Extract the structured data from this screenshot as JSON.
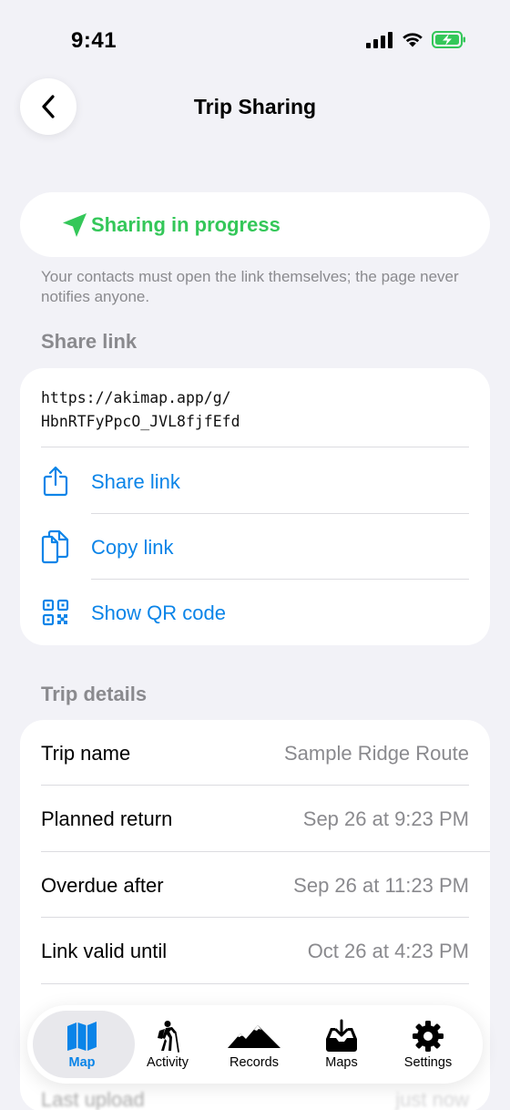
{
  "status_bar": {
    "time": "9:41"
  },
  "nav": {
    "title": "Trip Sharing"
  },
  "sharing_status": {
    "label": "Sharing in progress",
    "color": "#34c759"
  },
  "footnote": "Your contacts must open the link themselves; the page never notifies anyone.",
  "share_link_section": {
    "header": "Share link",
    "url_line1": "https://akimap.app/g/",
    "url_line2": "HbnRTFyPpcO_JVL8fjfEfd",
    "actions": [
      {
        "label": "Share link",
        "icon": "share-icon"
      },
      {
        "label": "Copy link",
        "icon": "copy-icon"
      },
      {
        "label": "Show QR code",
        "icon": "qr-code-icon"
      }
    ]
  },
  "trip_details": {
    "header": "Trip details",
    "rows": [
      {
        "key": "Trip name",
        "value": "Sample Ridge Route"
      },
      {
        "key": "Planned return",
        "value": "Sep 26 at 9:23 PM"
      },
      {
        "key": "Overdue after",
        "value": "Sep 26 at 11:23 PM"
      },
      {
        "key": "Link valid until",
        "value": "Oct 26 at 4:23 PM"
      },
      {
        "key": "Last upload",
        "value": "just now"
      }
    ]
  },
  "tab_bar": {
    "tabs": [
      {
        "label": "Map",
        "icon": "map-icon",
        "active": true
      },
      {
        "label": "Activity",
        "icon": "hiker-icon",
        "active": false
      },
      {
        "label": "Records",
        "icon": "mountains-icon",
        "active": false
      },
      {
        "label": "Maps",
        "icon": "download-tray-icon",
        "active": false
      },
      {
        "label": "Settings",
        "icon": "gear-icon",
        "active": false
      }
    ]
  },
  "colors": {
    "accent": "#0a84e8",
    "success": "#34c759",
    "secondary_text": "#8a8a8e",
    "background": "#f2f2f7"
  }
}
